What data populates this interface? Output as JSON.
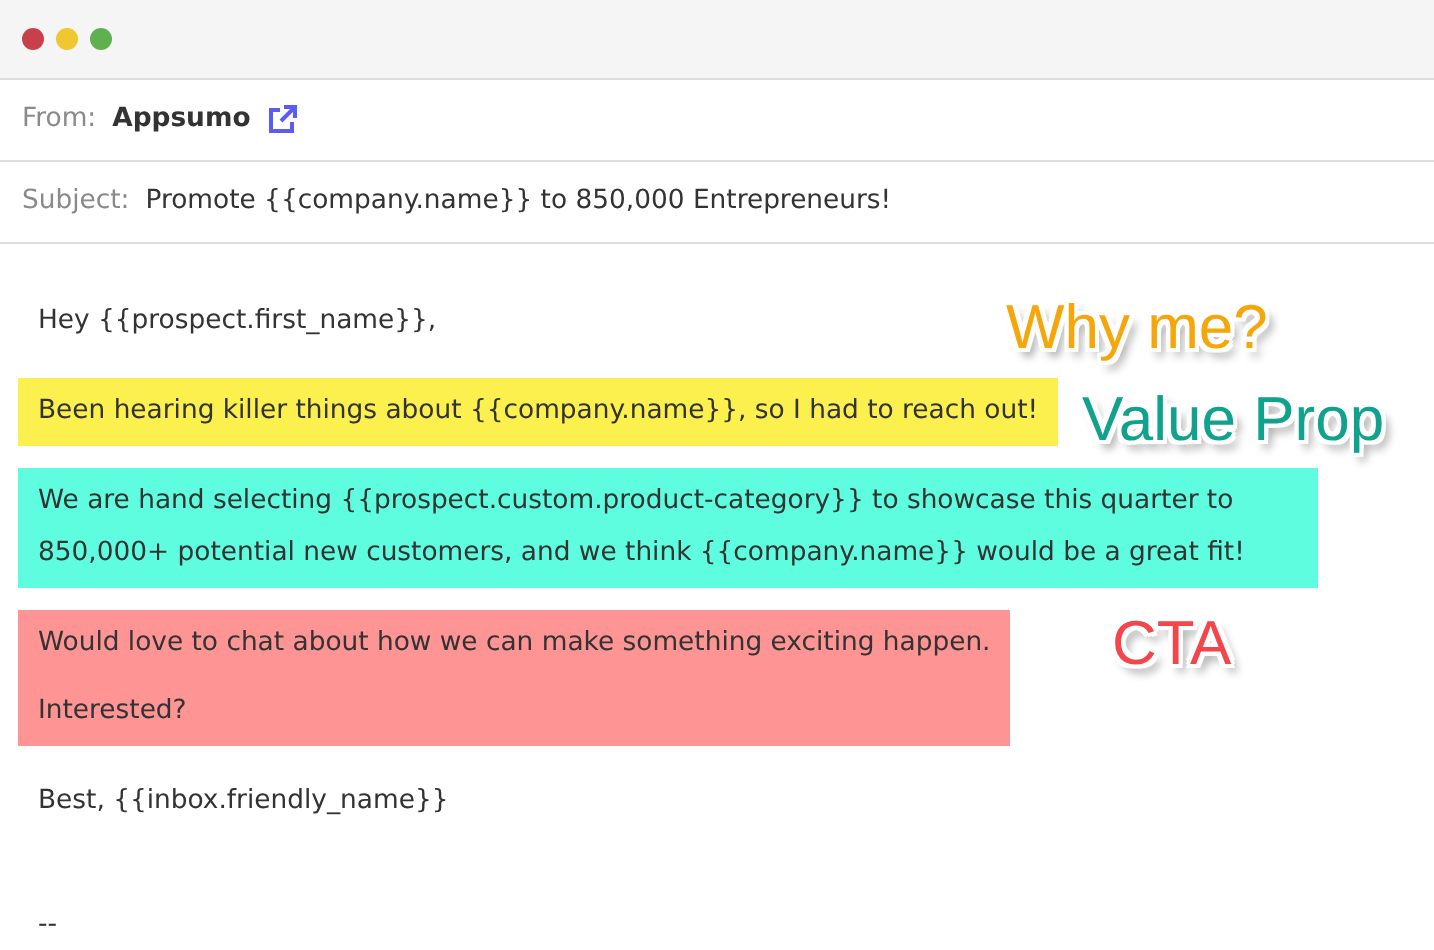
{
  "window": {
    "controls": [
      {
        "color": "#c8414a"
      },
      {
        "color": "#f0c72f"
      },
      {
        "color": "#5fb04f"
      }
    ]
  },
  "from": {
    "label": "From:",
    "value": "Appsumo"
  },
  "subject": {
    "label": "Subject:",
    "value": "Promote {{company.name}} to 850,000 Entrepreneurs!"
  },
  "body": [
    {
      "kind": "plain",
      "paragraphs": [
        "Hey {{prospect.first_name}},"
      ]
    },
    {
      "kind": "highlight",
      "color": "#fbf04e",
      "paragraphs": [
        "Been hearing killer things about {{company.name}}, so I had to reach out!"
      ]
    },
    {
      "kind": "highlight",
      "color": "#5ffde0",
      "paragraphs": [
        "We are hand selecting {{prospect.custom.product-category}} to showcase this quarter to 850,000+ potential new customers, and we think {{company.name}} would be a great fit!"
      ]
    },
    {
      "kind": "highlight",
      "color": "#ff9494",
      "paragraphs": [
        "Would love to chat about how we can make something exciting happen.",
        "Interested?"
      ]
    },
    {
      "kind": "plain",
      "paragraphs": [
        "Best, {{inbox.friendly_name}}"
      ]
    },
    {
      "kind": "signature",
      "paragraphs": [
        "--"
      ]
    }
  ],
  "annotations": [
    {
      "text": "Why me?",
      "color": "#f5a60a"
    },
    {
      "text": "Value Prop",
      "color": "#10a28c"
    },
    {
      "text": "CTA",
      "color": "#f2464a"
    }
  ]
}
